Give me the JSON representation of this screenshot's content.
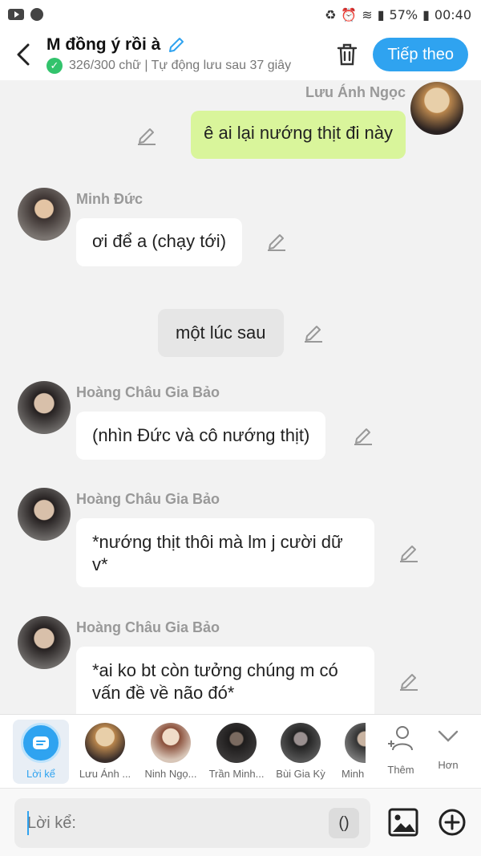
{
  "status_bar": {
    "battery": "57%",
    "time": "00:40"
  },
  "header": {
    "title": "M đồng ý rồi à",
    "subtitle": "326/300 chữ | Tự động lưu sau 37 giây",
    "next_label": "Tiếp theo"
  },
  "messages": [
    {
      "sender": "Lưu Ánh Ngọc",
      "text": "ê ai lại nướng thịt đi này"
    },
    {
      "sender": "Minh Đức",
      "text": "ơi để a (chạy tới)"
    },
    {
      "sender": "",
      "text": "một lúc sau"
    },
    {
      "sender": "Hoàng Châu Gia Bảo",
      "text": "(nhìn Đức và cô nướng thịt)"
    },
    {
      "sender": "Hoàng Châu Gia Bảo",
      "text": "*nướng thịt thôi mà lm j cười dữ v*"
    },
    {
      "sender": "Hoàng Châu Gia Bảo",
      "text": "*ai ko bt còn tưởng chúng m có vấn đề về  não đó*"
    }
  ],
  "characters": [
    {
      "label": "Lời kể"
    },
    {
      "label": "Lưu Ánh ..."
    },
    {
      "label": "Ninh Ngọ..."
    },
    {
      "label": "Trần Minh..."
    },
    {
      "label": "Bùi Gia Kỳ"
    },
    {
      "label": "Minh"
    }
  ],
  "more_label": "Thêm",
  "hon_label": "Hơn",
  "input": {
    "placeholder": "Lời kể:",
    "paren_label": "()"
  },
  "colors": {
    "accent": "#2fa3f0",
    "my_bubble": "#d9f59b",
    "background": "#f2f2f2"
  }
}
